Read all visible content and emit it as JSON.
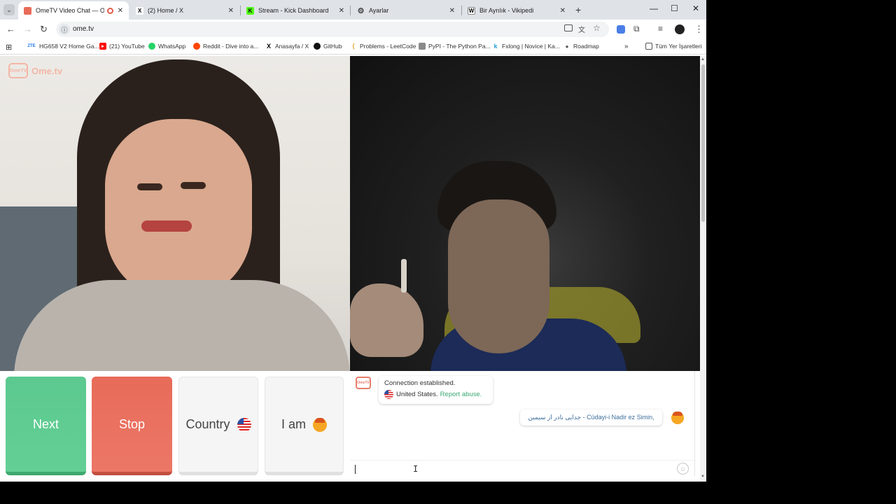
{
  "browser": {
    "tabs": [
      {
        "title": "OmeTV Video Chat — Ome",
        "active": true
      },
      {
        "title": "(2) Home / X"
      },
      {
        "title": "Stream - Kick Dashboard"
      },
      {
        "title": "Ayarlar"
      },
      {
        "title": "Bir Ayrılık - Vikipedi"
      }
    ],
    "url": "ome.tv",
    "bookmarks": [
      "HG658 V2 Home Ga...",
      "(21) YouTube",
      "WhatsApp",
      "Reddit - Dive into a...",
      "Anasayfa / X",
      "GitHub",
      "Problems - LeetCode",
      "PyPI - The Python Pa...",
      "Fxlong | Novice | Ka...",
      "Roadmap"
    ],
    "all_bookmarks": "Tüm Yer İşaretleri",
    "more_bookmarks": "»"
  },
  "site": {
    "logo_badge_line1": "Ome",
    "logo_badge_line2": "TV",
    "logo_text": "Ome.tv"
  },
  "controls": {
    "next": "Next",
    "stop": "Stop",
    "country": "Country",
    "gender": "I am"
  },
  "chat": {
    "sys_line1": "Connection established.",
    "sys_country": "United States.",
    "sys_report": "Report abuse.",
    "message": "جدایی نادر از سیمین - Cüdayi-i Nadir ez Simin,",
    "emoji_icon": "☺"
  },
  "icons": {
    "dropdown": "⌄",
    "close": "✕",
    "newtab": "+",
    "minimize": "—",
    "maximize": "☐",
    "winclose": "✕",
    "back": "←",
    "forward": "→",
    "reload": "↻",
    "site_info": "ⓘ",
    "apps": "⊞",
    "star": "☆",
    "menu": "⋮",
    "folder": "🗀",
    "ibeam": "I"
  }
}
